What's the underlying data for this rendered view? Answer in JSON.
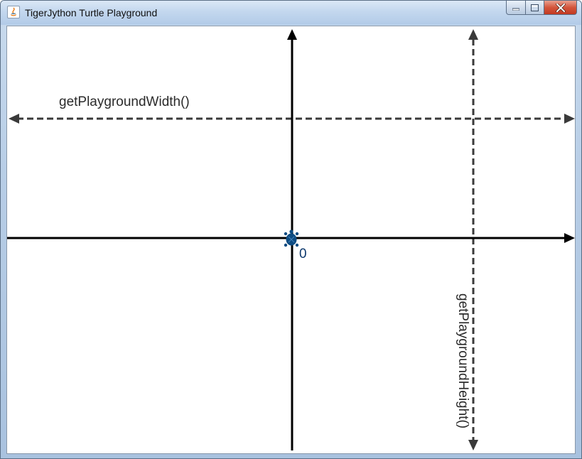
{
  "window": {
    "title": "TigerJython Turtle Playground",
    "app_icon": "java-icon",
    "controls": {
      "minimize": "minimize-icon",
      "maximize": "maximize-icon",
      "close": "close-icon"
    }
  },
  "playground": {
    "width_label": "getPlaygroundWidth()",
    "height_label": "getPlaygroundHeight()",
    "origin_label": "0",
    "turtle_icon": "turtle-icon",
    "colors": {
      "background": "#ffffff",
      "axes": "#000000",
      "dimension_arrows": "#3a3a3a",
      "turtle": "#0e4c82"
    }
  }
}
